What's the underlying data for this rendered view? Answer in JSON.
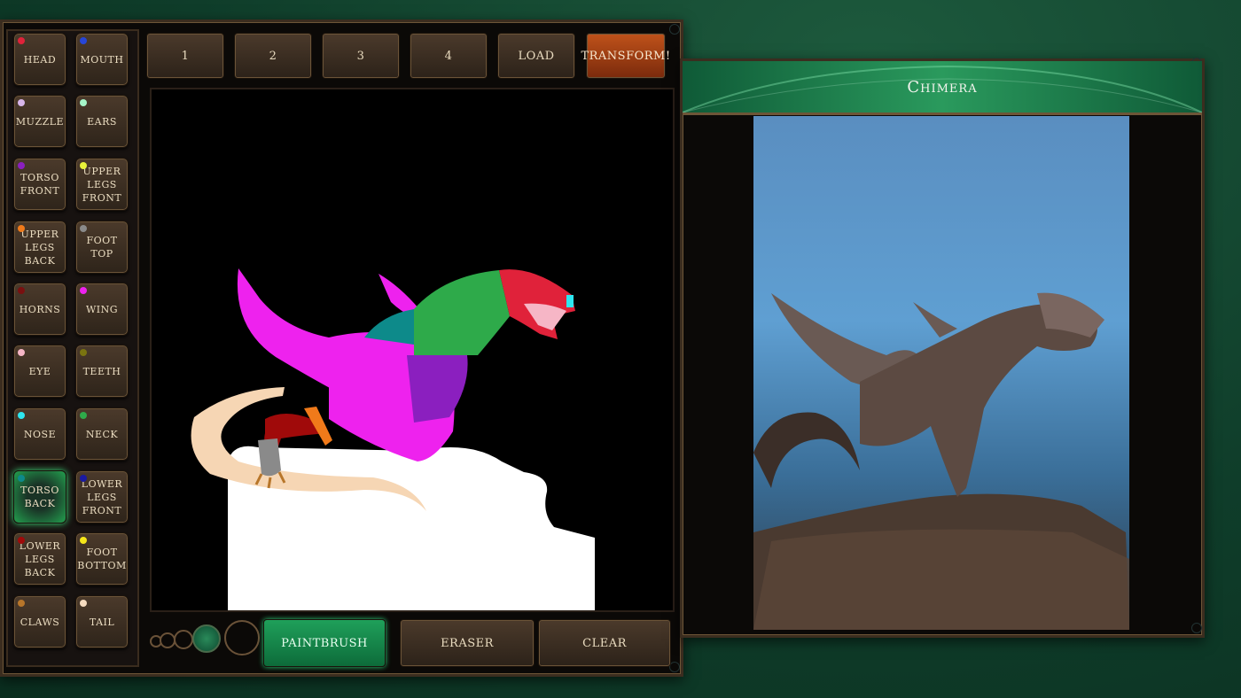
{
  "body_parts": [
    {
      "label": "HEAD",
      "color": "#e0223a"
    },
    {
      "label": "MOUTH",
      "color": "#2746d8"
    },
    {
      "label": "MUZZLE",
      "color": "#d8b6ea"
    },
    {
      "label": "EARS",
      "color": "#a6f5c8"
    },
    {
      "label": "TORSO FRONT",
      "color": "#8b1fbf"
    },
    {
      "label": "UPPER LEGS FRONT",
      "color": "#e8f23a"
    },
    {
      "label": "UPPER LEGS BACK",
      "color": "#f07a1a"
    },
    {
      "label": "FOOT TOP",
      "color": "#8a8a8a"
    },
    {
      "label": "HORNS",
      "color": "#7a1010"
    },
    {
      "label": "WING",
      "color": "#ee22ee"
    },
    {
      "label": "EYE",
      "color": "#f6b6c6"
    },
    {
      "label": "TEETH",
      "color": "#7a7410"
    },
    {
      "label": "NOSE",
      "color": "#2ee6f0"
    },
    {
      "label": "NECK",
      "color": "#2eaa4a"
    },
    {
      "label": "TORSO BACK",
      "color": "#0d8a8a",
      "active": true
    },
    {
      "label": "LOWER LEGS FRONT",
      "color": "#1a1aa0"
    },
    {
      "label": "LOWER LEGS BACK",
      "color": "#a00a0a"
    },
    {
      "label": "FOOT BOTTOM",
      "color": "#f6e61a"
    },
    {
      "label": "CLAWS",
      "color": "#b8762a"
    },
    {
      "label": "TAIL",
      "color": "#f6dcc0"
    }
  ],
  "toolbar": {
    "slot1": "1",
    "slot2": "2",
    "slot3": "3",
    "slot4": "4",
    "load": "LOAD",
    "transform": "TRANSFORM!"
  },
  "tools": {
    "paintbrush": "PAINTBRUSH",
    "eraser": "ERASER",
    "clear": "CLEAR"
  },
  "result": {
    "title": "Chimera"
  },
  "colors": {
    "accent_green": "#1fa05a",
    "transform_orange": "#c0521a",
    "frame_brown": "#3b2d1f"
  },
  "brush_sizes": [
    "tiny",
    "small",
    "medium",
    "large",
    "xlarge"
  ],
  "selected_brush": "large"
}
